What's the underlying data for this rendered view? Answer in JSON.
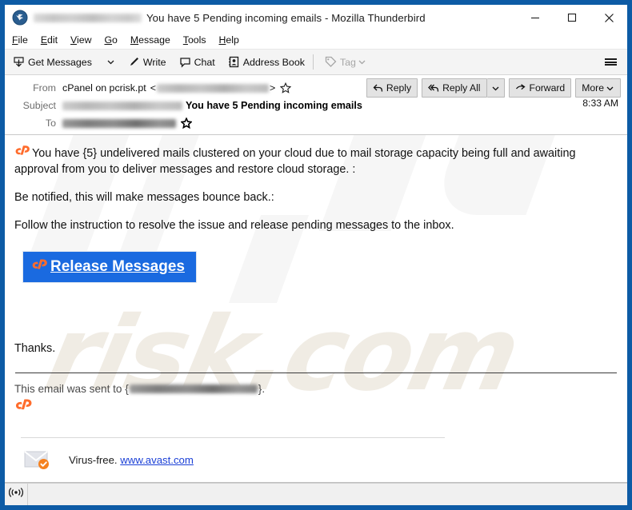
{
  "window": {
    "title": "You have 5 Pending incoming emails - Mozilla Thunderbird",
    "app_icon": "thunderbird-icon",
    "minimize_label": "Minimize",
    "maximize_label": "Maximize",
    "close_label": "Close"
  },
  "menubar": {
    "items": [
      {
        "label": "File",
        "accel": "F"
      },
      {
        "label": "Edit",
        "accel": "E"
      },
      {
        "label": "View",
        "accel": "V"
      },
      {
        "label": "Go",
        "accel": "G"
      },
      {
        "label": "Message",
        "accel": "M"
      },
      {
        "label": "Tools",
        "accel": "T"
      },
      {
        "label": "Help",
        "accel": "H"
      }
    ]
  },
  "toolbar": {
    "get_messages": "Get Messages",
    "write": "Write",
    "chat": "Chat",
    "address_book": "Address Book",
    "tag": "Tag",
    "app_menu": "Application Menu"
  },
  "header": {
    "from_label": "From",
    "from_value": "cPanel on pcrisk.pt",
    "from_address_redacted": true,
    "from_bracket_open": "<",
    "from_bracket_close": ">",
    "subject_label": "Subject",
    "subject_prefix_redacted": true,
    "subject_value": "You have 5 Pending incoming emails",
    "to_label": "To",
    "to_value_redacted": true,
    "time": "8:33 AM",
    "buttons": {
      "reply": "Reply",
      "reply_all": "Reply All",
      "forward": "Forward",
      "more": "More"
    }
  },
  "message": {
    "paragraph1": "You have {5} undelivered mails clustered on your cloud due to mail storage capacity being full and awaiting approval from you to deliver messages and restore cloud storage. :",
    "paragraph2": "Be notified, this will make messages bounce back.:",
    "paragraph3": "Follow the instruction to resolve the issue and release pending messages to the inbox.",
    "cta_label": "Release Messages",
    "cta_color": "#1a6ae0",
    "thanks": "Thanks.",
    "sent_to_prefix": "This email was sent to {",
    "sent_to_suffix": "}.",
    "brand_logo": "cpanel-logo"
  },
  "footer": {
    "virus_free_text": "Virus-free.",
    "avast_link": "www.avast.com",
    "link_color": "#1a3fd6",
    "badge_color": "#f58220"
  },
  "statusbar": {
    "indicator": "broadcast-icon"
  },
  "watermark": {
    "text": "risk.com"
  }
}
